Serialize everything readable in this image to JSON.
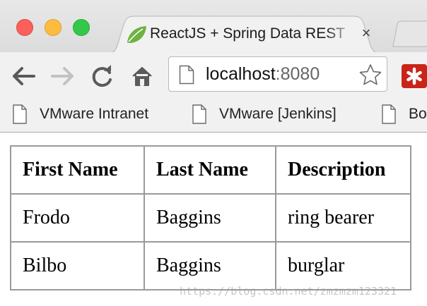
{
  "browser": {
    "tab": {
      "title": "ReactJS + Spring Data REST",
      "close_glyph": "×",
      "favicon": "spring-leaf-icon"
    },
    "address_bar": {
      "host": "localhost",
      "port": ":8080"
    },
    "bookmarks": [
      {
        "label": "VMware Intranet",
        "icon": "page-icon"
      },
      {
        "label": "VMware [Jenkins]",
        "icon": "page-icon"
      },
      {
        "label": "Bo",
        "icon": "page-icon"
      }
    ]
  },
  "table": {
    "headers": [
      "First Name",
      "Last Name",
      "Description"
    ],
    "rows": [
      [
        "Frodo",
        "Baggins",
        "ring bearer"
      ],
      [
        "Bilbo",
        "Baggins",
        "burglar"
      ]
    ]
  },
  "watermark": "https://blog.csdn.net/zmzmzm123321",
  "colors": {
    "close_red": "#fc605b",
    "minimize_yellow": "#fdbc40",
    "zoom_green": "#34c84a",
    "table_border": "#9a9a9a"
  }
}
